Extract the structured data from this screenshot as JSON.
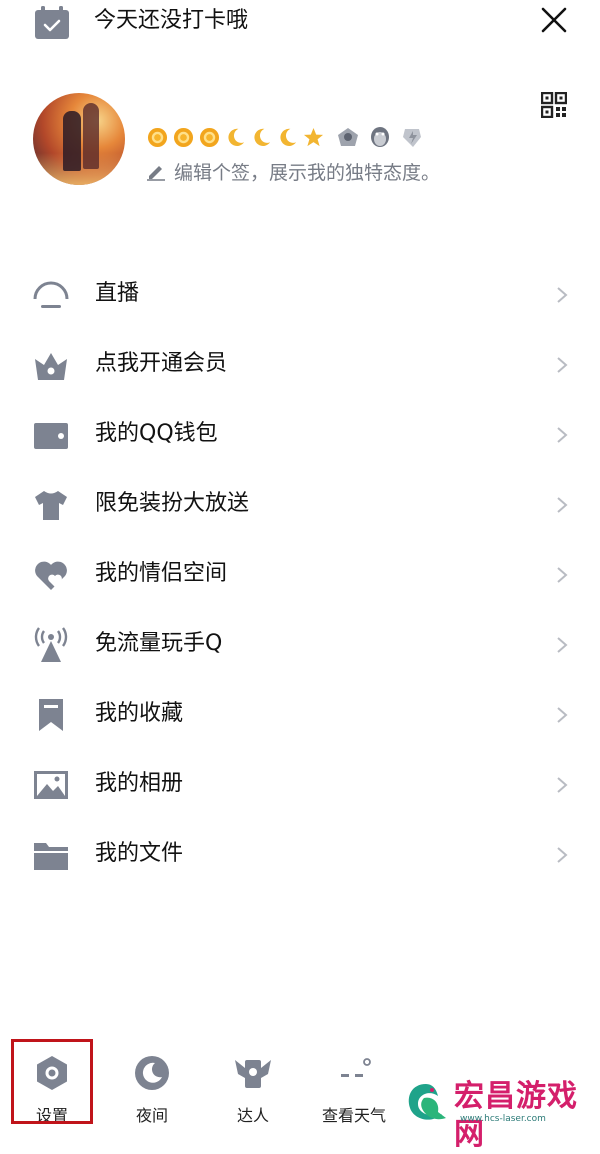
{
  "topbar": {
    "checkin_text": "今天还没打卡哦"
  },
  "profile": {
    "signature": "编辑个签，展示我的独特态度。"
  },
  "menu": [
    {
      "label": "直播",
      "icon": "live-icon"
    },
    {
      "label": "点我开通会员",
      "icon": "vip-crown-icon"
    },
    {
      "label": "我的QQ钱包",
      "icon": "wallet-icon"
    },
    {
      "label": "限免装扮大放送",
      "icon": "tshirt-icon"
    },
    {
      "label": "我的情侣空间",
      "icon": "couple-heart-icon"
    },
    {
      "label": "免流量玩手Q",
      "icon": "signal-tower-icon"
    },
    {
      "label": "我的收藏",
      "icon": "bookmark-icon"
    },
    {
      "label": "我的相册",
      "icon": "photo-album-icon"
    },
    {
      "label": "我的文件",
      "icon": "folder-icon"
    }
  ],
  "bottom": [
    {
      "label": "设置",
      "icon": "settings-icon"
    },
    {
      "label": "夜间",
      "icon": "night-mode-icon"
    },
    {
      "label": "达人",
      "icon": "expert-icon"
    },
    {
      "label": "查看天气",
      "icon": "weather-icon"
    }
  ],
  "watermark": {
    "title": "宏昌游戏网",
    "url": "www.hcs-laser.com"
  },
  "colors": {
    "icon_gray": "#7d8391",
    "highlight_red": "#c0141a",
    "watermark_pink": "#d41f6b"
  }
}
